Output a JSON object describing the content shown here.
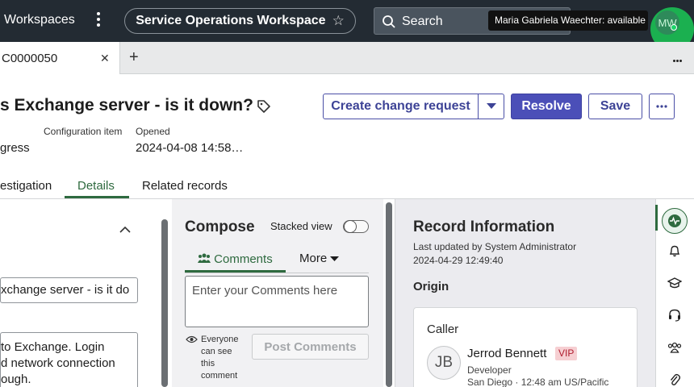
{
  "topbar": {
    "workspaces_label": "Workspaces",
    "workspace_name": "Service Operations Workspace",
    "search_label": "Search",
    "user_tooltip": "Maria Gabriela Waechter: available",
    "user_initials": "MW"
  },
  "tabs": {
    "active_label": "C0000050",
    "close_glyph": "✕",
    "add_glyph": "+"
  },
  "record": {
    "title": "s Exchange server - is it down?",
    "state_value": "gress",
    "config_item_label": "Configuration item",
    "opened_label": "Opened",
    "opened_value": "2024-04-08 14:58…"
  },
  "actions": {
    "create_change": "Create change request",
    "resolve": "Resolve",
    "save": "Save"
  },
  "record_tabs": {
    "investigation": "estigation",
    "details": "Details",
    "related": "Related records"
  },
  "form": {
    "short_description": "xchange server - is it do",
    "description_line1": "to Exchange. Login",
    "description_line2": "d network connection",
    "description_line3": "ough."
  },
  "compose": {
    "title": "Compose",
    "stacked_view": "Stacked view",
    "comments_tab": "Comments",
    "more_tab": "More",
    "placeholder": "Enter your Comments here",
    "visibility": "Everyone can see this comment",
    "post_button": "Post Comments"
  },
  "record_info": {
    "title": "Record Information",
    "updated_by": "Last updated by System Administrator",
    "updated_at": "2024-04-29 12:49:40",
    "origin": "Origin",
    "caller_label": "Caller",
    "caller_initials": "JB",
    "caller_name": "Jerrod Bennett",
    "vip": "VIP",
    "caller_role": "Developer",
    "caller_location": "San Diego · 12:48 am US/Pacific"
  },
  "colors": {
    "topbar": "#232b33",
    "primary": "#4b4fb8",
    "accent_green": "#2e6a3f",
    "vip_bg": "#f6cfd2"
  },
  "icons": {
    "rail": [
      "activity-icon",
      "bell-icon",
      "graduation-cap-icon",
      "headset-icon",
      "people-icon",
      "paperclip-icon"
    ]
  }
}
